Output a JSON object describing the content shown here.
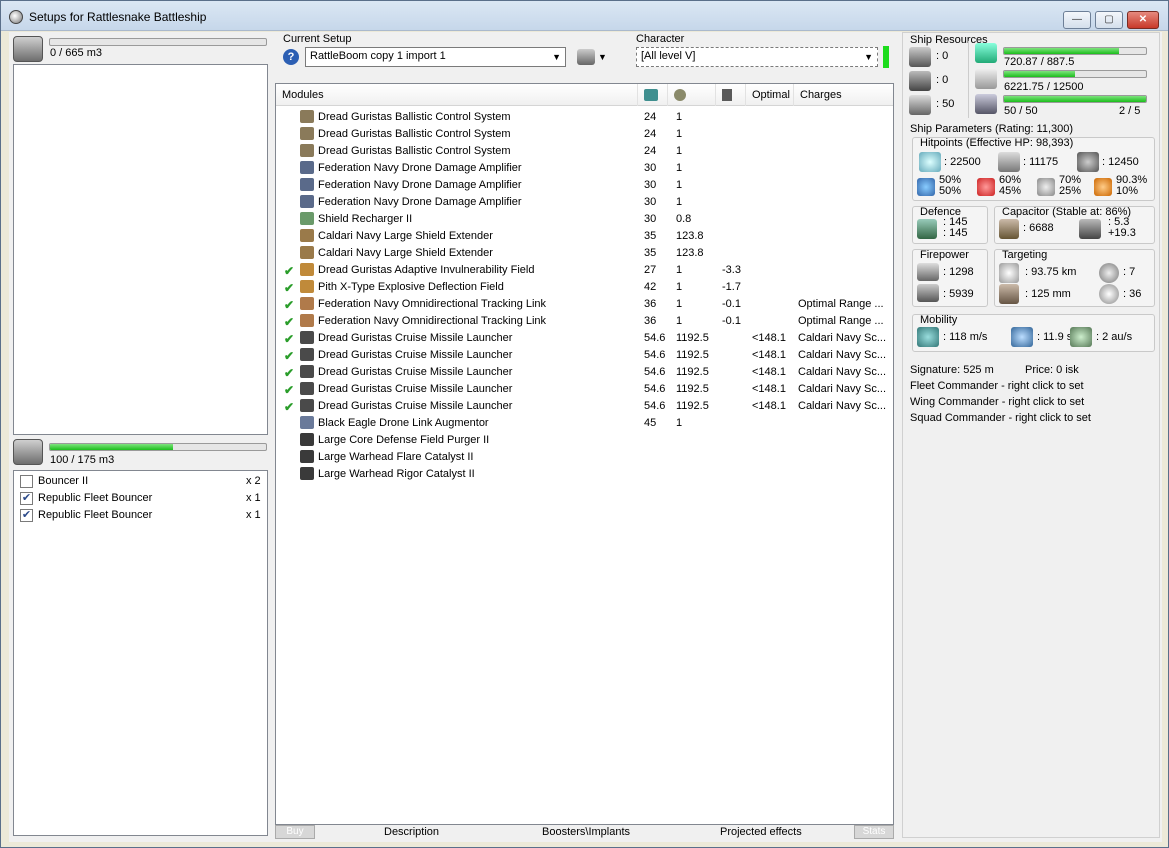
{
  "window": {
    "title": "Setups for Rattlesnake Battleship",
    "min": "—",
    "max": "▢",
    "close": "✕"
  },
  "cargo": {
    "value": "0 / 665 m3",
    "fill": 0
  },
  "drone_bay": {
    "value": "100 / 175 m3",
    "fill": 0.571
  },
  "drones": [
    {
      "name": "Bouncer II",
      "count": "x 2",
      "checked": false
    },
    {
      "name": "Republic Fleet Bouncer",
      "count": "x 1",
      "checked": true
    },
    {
      "name": "Republic Fleet Bouncer",
      "count": "x 1",
      "checked": true
    }
  ],
  "setup": {
    "label": "Current Setup",
    "value": "RattleBoom copy 1 import 1",
    "help": "?"
  },
  "character": {
    "label": "Character",
    "value": "[All level V]"
  },
  "modules": {
    "headers": {
      "name": "Modules",
      "optimal": "Optimal",
      "charges": "Charges"
    },
    "rows": [
      {
        "check": "",
        "name": "Dread Guristas Ballistic Control System",
        "c1": "24",
        "c2": "1",
        "c3": "",
        "c4": "",
        "charge": "",
        "color": "#8a7a5a"
      },
      {
        "check": "",
        "name": "Dread Guristas Ballistic Control System",
        "c1": "24",
        "c2": "1",
        "c3": "",
        "c4": "",
        "charge": "",
        "color": "#8a7a5a"
      },
      {
        "check": "",
        "name": "Dread Guristas Ballistic Control System",
        "c1": "24",
        "c2": "1",
        "c3": "",
        "c4": "",
        "charge": "",
        "color": "#8a7a5a"
      },
      {
        "check": "",
        "name": "Federation Navy Drone Damage Amplifier",
        "c1": "30",
        "c2": "1",
        "c3": "",
        "c4": "",
        "charge": "",
        "color": "#5a6a8a"
      },
      {
        "check": "",
        "name": "Federation Navy Drone Damage Amplifier",
        "c1": "30",
        "c2": "1",
        "c3": "",
        "c4": "",
        "charge": "",
        "color": "#5a6a8a"
      },
      {
        "check": "",
        "name": "Federation Navy Drone Damage Amplifier",
        "c1": "30",
        "c2": "1",
        "c3": "",
        "c4": "",
        "charge": "",
        "color": "#5a6a8a"
      },
      {
        "check": "",
        "name": "Shield Recharger II",
        "c1": "30",
        "c2": "0.8",
        "c3": "",
        "c4": "",
        "charge": "",
        "color": "#6a9a6a"
      },
      {
        "check": "",
        "name": "Caldari Navy Large Shield Extender",
        "c1": "35",
        "c2": "123.8",
        "c3": "",
        "c4": "",
        "charge": "",
        "color": "#9a7a4a"
      },
      {
        "check": "",
        "name": "Caldari Navy Large Shield Extender",
        "c1": "35",
        "c2": "123.8",
        "c3": "",
        "c4": "",
        "charge": "",
        "color": "#9a7a4a"
      },
      {
        "check": "✔",
        "name": "Dread Guristas Adaptive Invulnerability Field",
        "c1": "27",
        "c2": "1",
        "c3": "-3.3",
        "c4": "",
        "charge": "",
        "color": "#c08a3a"
      },
      {
        "check": "✔",
        "name": "Pith X-Type Explosive Deflection Field",
        "c1": "42",
        "c2": "1",
        "c3": "-1.7",
        "c4": "",
        "charge": "",
        "color": "#c08a3a"
      },
      {
        "check": "✔",
        "name": "Federation Navy Omnidirectional Tracking Link",
        "c1": "36",
        "c2": "1",
        "c3": "-0.1",
        "c4": "",
        "charge": "Optimal Range ...",
        "color": "#b07a4a"
      },
      {
        "check": "✔",
        "name": "Federation Navy Omnidirectional Tracking Link",
        "c1": "36",
        "c2": "1",
        "c3": "-0.1",
        "c4": "",
        "charge": "Optimal Range ...",
        "color": "#b07a4a"
      },
      {
        "check": "✔",
        "name": "Dread Guristas Cruise Missile Launcher",
        "c1": "54.6",
        "c2": "1192.5",
        "c3": "",
        "c4": "<148.1",
        "charge": "Caldari Navy Sc...",
        "color": "#4a4a4a"
      },
      {
        "check": "✔",
        "name": "Dread Guristas Cruise Missile Launcher",
        "c1": "54.6",
        "c2": "1192.5",
        "c3": "",
        "c4": "<148.1",
        "charge": "Caldari Navy Sc...",
        "color": "#4a4a4a"
      },
      {
        "check": "✔",
        "name": "Dread Guristas Cruise Missile Launcher",
        "c1": "54.6",
        "c2": "1192.5",
        "c3": "",
        "c4": "<148.1",
        "charge": "Caldari Navy Sc...",
        "color": "#4a4a4a"
      },
      {
        "check": "✔",
        "name": "Dread Guristas Cruise Missile Launcher",
        "c1": "54.6",
        "c2": "1192.5",
        "c3": "",
        "c4": "<148.1",
        "charge": "Caldari Navy Sc...",
        "color": "#4a4a4a"
      },
      {
        "check": "✔",
        "name": "Dread Guristas Cruise Missile Launcher",
        "c1": "54.6",
        "c2": "1192.5",
        "c3": "",
        "c4": "<148.1",
        "charge": "Caldari Navy Sc...",
        "color": "#4a4a4a"
      },
      {
        "check": "",
        "name": "Black Eagle Drone Link Augmentor",
        "c1": "45",
        "c2": "1",
        "c3": "",
        "c4": "",
        "charge": "",
        "color": "#6a7a9a"
      },
      {
        "check": "",
        "name": "Large Core Defense Field Purger II",
        "c1": "",
        "c2": "",
        "c3": "",
        "c4": "",
        "charge": "",
        "color": "#3a3a3a"
      },
      {
        "check": "",
        "name": "Large Warhead Flare Catalyst II",
        "c1": "",
        "c2": "",
        "c3": "",
        "c4": "",
        "charge": "",
        "color": "#3a3a3a"
      },
      {
        "check": "",
        "name": "Large Warhead Rigor Catalyst II",
        "c1": "",
        "c2": "",
        "c3": "",
        "c4": "",
        "charge": "",
        "color": "#3a3a3a"
      }
    ]
  },
  "tabs": {
    "buy": "Buy",
    "description": "Description",
    "boosters": "Boosters\\Implants",
    "projected": "Projected effects",
    "stats": "Stats"
  },
  "resources": {
    "title": "Ship Resources",
    "turrets": ": 0",
    "launchers": ": 0",
    "calibration": ": 50",
    "cpu": {
      "value": "720.87 / 887.5",
      "fill": 0.812
    },
    "power": {
      "value": "6221.75 / 12500",
      "fill": 0.498
    },
    "drone_bw": {
      "value": "50 / 50",
      "fill": 1.0
    },
    "drones_active": "2 / 5"
  },
  "params": {
    "title": "Ship Parameters (Rating: 11,300)",
    "hitpoints": "Hitpoints (Effective HP: 98,393)",
    "shield_hp": ": 22500",
    "armor_hp": ": 11175",
    "hull_hp": ": 12450",
    "res_em": [
      "50%",
      "50%"
    ],
    "res_th": [
      "60%",
      "45%"
    ],
    "res_ki": [
      "70%",
      "25%"
    ],
    "res_ex": [
      "90.3%",
      "10%"
    ],
    "defence": {
      "title": "Defence",
      "v1": ": 145",
      "v2": ": 145"
    },
    "capacitor": {
      "title": "Capacitor (Stable at: 86%)",
      "cap": ": 6688",
      "v1": ": 5.3",
      "v2": "+19.3"
    },
    "firepower": {
      "title": "Firepower",
      "v1": ": 1298",
      "v2": ": 5939"
    },
    "targeting": {
      "title": "Targeting",
      "range": ": 93.75 km",
      "targets": ": 7",
      "res": ": 125 mm",
      "scan": ": 36"
    },
    "mobility": {
      "title": "Mobility",
      "speed": ": 118 m/s",
      "align": ": 11.9 s",
      "warp": ": 2 au/s"
    },
    "signature": "Signature: 525 m",
    "price": "Price: 0 isk",
    "fleet": "Fleet Commander - right click to set",
    "wing": "Wing Commander - right click to set",
    "squad": "Squad Commander - right click to set"
  },
  "colors": {
    "green": "#1cbe1c",
    "accent": "#2c4a8a"
  }
}
